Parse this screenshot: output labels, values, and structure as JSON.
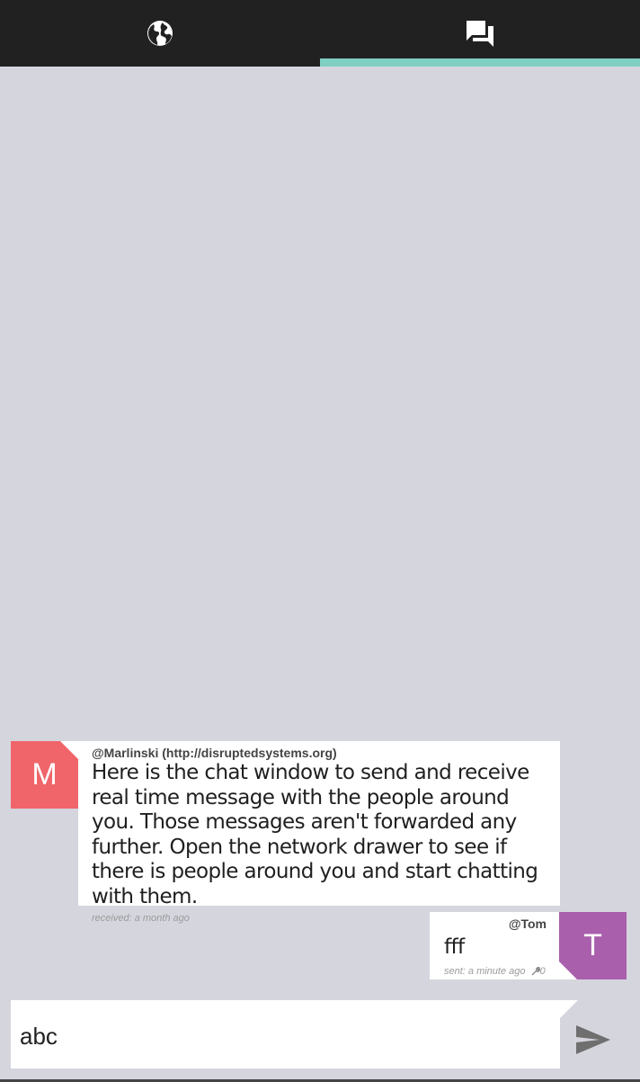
{
  "tabs": [
    {
      "name": "network",
      "icon": "globe-icon",
      "active": false
    },
    {
      "name": "chat",
      "icon": "chat-bubbles-icon",
      "active": true
    }
  ],
  "colors": {
    "tabbar": "#212121",
    "active_indicator": "#7fcfc3",
    "background": "#d5d5de",
    "avatar_m": "#f0656a",
    "avatar_t": "#a95fab"
  },
  "messages": [
    {
      "direction": "received",
      "avatar_letter": "M",
      "sender": "@Marlinski (http://disruptedsystems.org)",
      "text": "Here is the chat window to send and receive real time message with the people around you. Those messages aren't forwarded any further. Open the network drawer to see if there is people around you and start chatting with them.",
      "meta": "received: a month ago"
    },
    {
      "direction": "sent",
      "avatar_letter": "T",
      "sender": "@Tom",
      "text": "fff",
      "meta": "sent: a minute ago",
      "hop_count": "0",
      "hop_icon": "wrench-icon"
    }
  ],
  "composer": {
    "value": "abc",
    "send_icon": "send-icon"
  }
}
